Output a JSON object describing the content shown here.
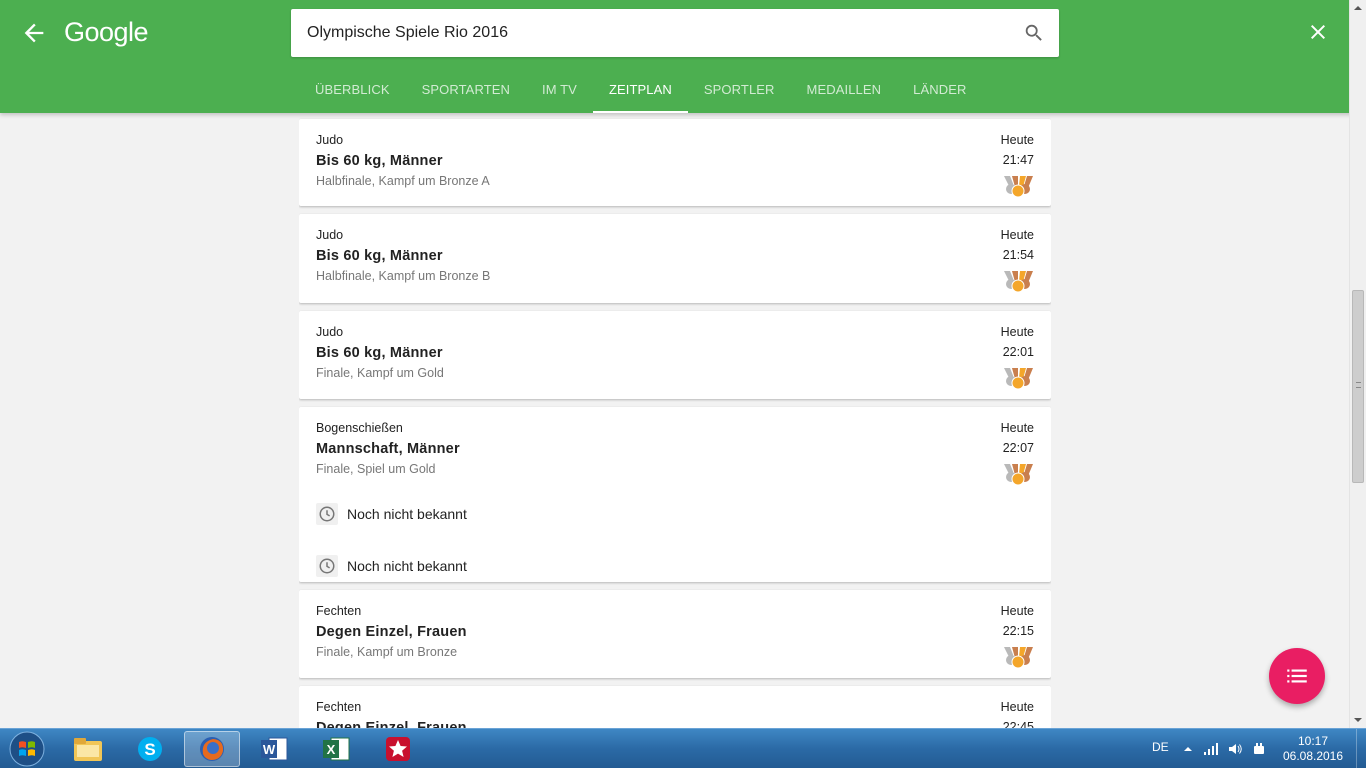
{
  "header": {
    "logo": "Google",
    "search_value": "Olympische Spiele Rio 2016",
    "tabs": [
      {
        "label": "ÜBERBLICK",
        "active": false
      },
      {
        "label": "SPORTARTEN",
        "active": false
      },
      {
        "label": "IM TV",
        "active": false
      },
      {
        "label": "ZEITPLAN",
        "active": true
      },
      {
        "label": "SPORTLER",
        "active": false
      },
      {
        "label": "MEDAILLEN",
        "active": false
      },
      {
        "label": "LÄNDER",
        "active": false
      }
    ]
  },
  "schedule": [
    {
      "sport": "Judo",
      "event": "Bis 60 kg, Männer",
      "phase": "Halbfinale, Kampf um Bronze A",
      "day": "Heute",
      "time": "21:47"
    },
    {
      "sport": "Judo",
      "event": "Bis 60 kg, Männer",
      "phase": "Halbfinale, Kampf um Bronze B",
      "day": "Heute",
      "time": "21:54"
    },
    {
      "sport": "Judo",
      "event": "Bis 60 kg, Männer",
      "phase": "Finale, Kampf um Gold",
      "day": "Heute",
      "time": "22:01"
    },
    {
      "sport": "Bogenschießen",
      "event": "Mannschaft, Männer",
      "phase": "Finale, Spiel um Gold",
      "day": "Heute",
      "time": "22:07",
      "tbd": [
        "Noch nicht bekannt",
        "Noch nicht bekannt"
      ]
    },
    {
      "sport": "Fechten",
      "event": "Degen Einzel, Frauen",
      "phase": "Finale, Kampf um Bronze",
      "day": "Heute",
      "time": "22:15"
    },
    {
      "sport": "Fechten",
      "event": "Degen Einzel, Frauen",
      "phase": "",
      "day": "Heute",
      "time": "22:45"
    }
  ],
  "icons": {
    "back": "arrow-back-icon",
    "search": "search-icon",
    "close": "close-icon",
    "medal": "medal-icon",
    "clock": "clock-icon",
    "fab": "list-icon"
  },
  "colors": {
    "header": "#4caf50",
    "fab": "#e91e63",
    "gold": "#f4a62a",
    "silver": "#b9b9b9",
    "bronze": "#c97f4e"
  },
  "taskbar": {
    "apps": [
      "Windows Explorer",
      "Skype",
      "Firefox",
      "Word",
      "Excel",
      "PokerStars"
    ],
    "language": "DE",
    "time": "10:17",
    "date": "06.08.2016"
  }
}
